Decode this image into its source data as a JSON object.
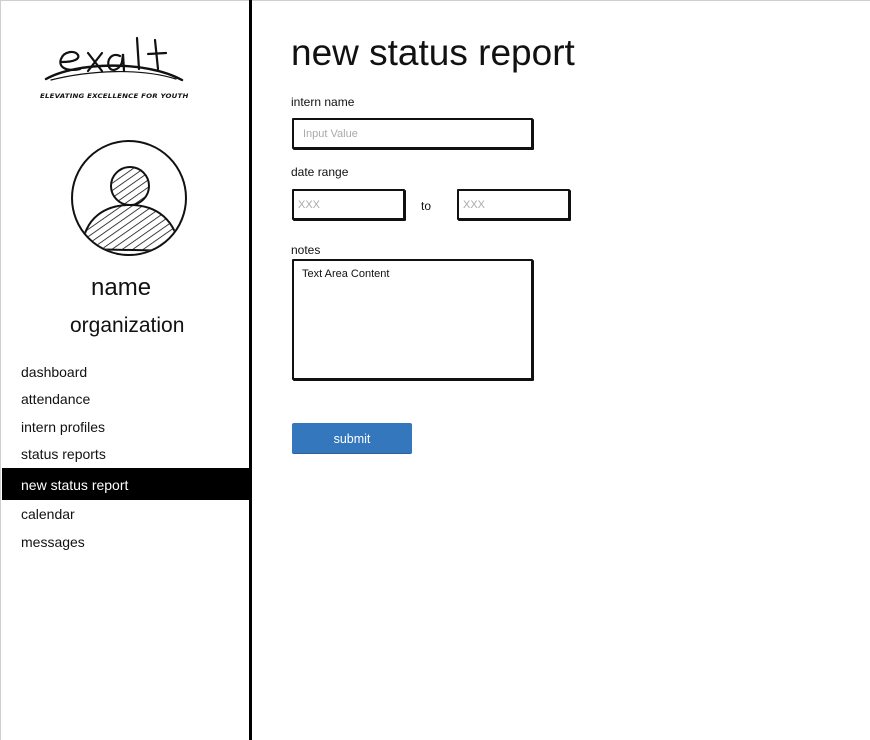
{
  "logo": {
    "wordmark": "exalt",
    "tagline": "ELEVATING EXCELLENCE FOR YOUTH"
  },
  "user": {
    "name": "name",
    "organization": "organization"
  },
  "nav": {
    "items": [
      {
        "label": "dashboard",
        "active": false
      },
      {
        "label": "attendance",
        "active": false
      },
      {
        "label": "intern profiles",
        "active": false
      },
      {
        "label": "status reports",
        "active": false
      },
      {
        "label": "new status report",
        "active": true
      },
      {
        "label": "calendar",
        "active": false
      },
      {
        "label": "messages",
        "active": false
      }
    ]
  },
  "form": {
    "title": "new status report",
    "intern_name": {
      "label": "intern name",
      "placeholder": "Input Value"
    },
    "date_range": {
      "label": "date range",
      "start_placeholder": "XXX",
      "separator": "to",
      "end_placeholder": "XXX"
    },
    "notes": {
      "label": "notes",
      "value": "Text Area Content"
    },
    "submit_label": "submit"
  },
  "colors": {
    "submit_button": "#3477bd",
    "active_nav_bg": "#000000",
    "active_nav_text": "#ffffff"
  }
}
